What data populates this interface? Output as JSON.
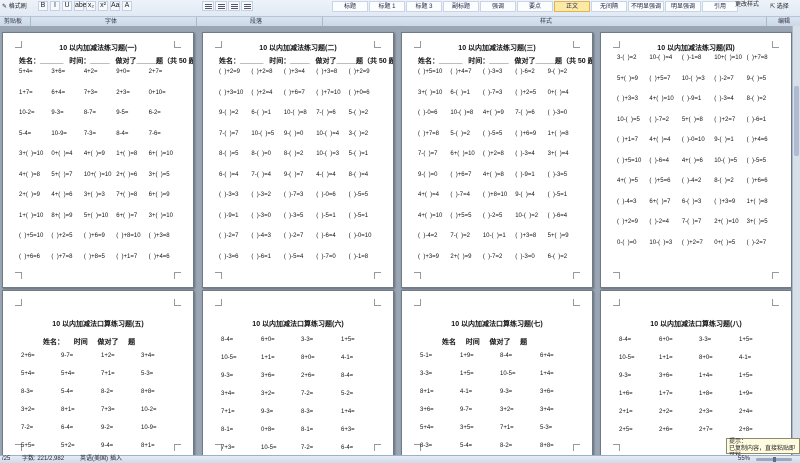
{
  "ribbon": {
    "format_painter": "格式刷",
    "font_buttons": [
      "B",
      "I",
      "U",
      "abe",
      "x₂",
      "x²",
      "Aa",
      "A"
    ],
    "para_buttons": [
      "≡",
      "≡",
      "≡",
      "≡"
    ],
    "styles": [
      "标题",
      "标题 1",
      "标题 3",
      "副标题",
      "强调",
      "要点",
      "正文",
      "无间隔",
      "不明显强调",
      "明显强调",
      "引用"
    ],
    "selected_style": "正文",
    "change_styles": "更改样式",
    "select": "选择",
    "groups": [
      "剪贴板",
      "字体",
      "段落",
      "样式",
      "编辑"
    ]
  },
  "pages": [
    {
      "title": "10 以内加减法练习题(一)",
      "info": "姓名：______   时间：_____   做对了_____题（共 50 题）",
      "rows": [
        [
          "5+4=",
          "3+6=",
          "4+2=",
          "9+0=",
          "2+7="
        ],
        [
          "1+7=",
          "6+4=",
          "7+3=",
          "2+3=",
          "0+10="
        ],
        [
          "10-2=",
          "9-3=",
          "8-7=",
          "9-5=",
          "6-2="
        ],
        [
          "5-4=",
          "10-9=",
          "7-3=",
          "8-4=",
          "7-6="
        ],
        [
          "3+(  )=10",
          "0+(  )=4",
          "4+(  )=9",
          "1+(  )=8",
          "6+(  )=10"
        ],
        [
          "4+(  )=8",
          "5+(  )=7",
          "10+(  )=10",
          "2+(  )=6",
          "3+(  )=5"
        ],
        [
          "2+(  )=9",
          "4+(  )=6",
          "3+(  )=3",
          "7+(  )=8",
          "6+(  )=9"
        ],
        [
          "1+(  )=10",
          "8+(  )=9",
          "5+(  )=10",
          "6+(  )=7",
          "3+(  )=10"
        ],
        [
          "(  )+5=10",
          "(  )+2=5",
          "(  )+6=9",
          "(  )+8=10",
          "(  )+3=8"
        ],
        [
          "(  )+6=6",
          "(  )+7=8",
          "(  )+8=5",
          "(  )+1=7",
          "(  )+4=6"
        ]
      ]
    },
    {
      "title": "10 以内加减法练习题(二)",
      "info": "姓名：______   时间：_____   做对了_____题（共 50 题）",
      "rows": [
        [
          "(  )+2=9",
          "(  )+2=8",
          "(  )+3=4",
          "(  )+3=8",
          "(  )+2=9"
        ],
        [
          "(  )+3=10",
          "(  )+2=4",
          "(  )+6=7",
          "(  )+7=10",
          "(  )+0=6"
        ],
        [
          "9-(  )=2",
          "6-(  )=1",
          "10-(  )=8",
          "7-(  )=6",
          "5-(  )=2"
        ],
        [
          "7-(  )=7",
          "10-(  )=5",
          "9-(  )=0",
          "10-(  )=4",
          "3-(  )=2"
        ],
        [
          "8-(  )=5",
          "8-(  )=0",
          "8-(  )=2",
          "10-(  )=3",
          "5-(  )=1"
        ],
        [
          "6-(  )=4",
          "7-(  )=4",
          "9-(  )=7",
          "4-(  )=4",
          "8-(  )=4"
        ],
        [
          "(  )-3=3",
          "(  )-3=2",
          "(  )-7=3",
          "(  )-0=6",
          "(  )-5=5"
        ],
        [
          "(  )-9=1",
          "(  )-3=0",
          "(  )-3=5",
          "(  )-5=1",
          "(  )-5=1"
        ],
        [
          "(  )-2=7",
          "(  )-4=3",
          "(  )-2=7",
          "(  )-6=4",
          "(  )-0=10"
        ],
        [
          "(  )-3=6",
          "(  )-6=1",
          "(  )-5=4",
          "(  )-7=0",
          "(  )-1=8"
        ]
      ]
    },
    {
      "title": "10 以内加减法练习题(三)",
      "info": "姓名：______   时间：_____   做对了_____题（共 50 题）",
      "rows": [
        [
          "(  )+5=10",
          "(  )+4=7",
          "(  )-3=3",
          "(  )-6=2",
          "9-(  )=2"
        ],
        [
          "3+(  )=10",
          "6-(  )=1",
          "(  )-7=3",
          "(  )+2=5",
          "0+(  )=4"
        ],
        [
          "(  )-0=6",
          "10-(  )=8",
          "4+(  )=9",
          "7-(  )=6",
          "(  )-3=0"
        ],
        [
          "(  )+7=8",
          "5-(  )=2",
          "(  )-5=5",
          "(  )+6=9",
          "1+(  )=8"
        ],
        [
          "7-(  )=7",
          "6+(  )=10",
          "(  )+2=8",
          "(  )-3=4",
          "3+(  )=4"
        ],
        [
          "9-(  )=0",
          "(  )+6=7",
          "4+(  )=8",
          "(  )-9=1",
          "(  )-3=5"
        ],
        [
          "4+(  )=4",
          "(  )-7=4",
          "(  )+8=10",
          "9-(  )=4",
          "(  )-5=1"
        ],
        [
          "4+(  )=10",
          "(  )+5=5",
          "(  )-2=5",
          "10-(  )=2",
          "(  )-6=4"
        ],
        [
          "(  )-4=2",
          "7-(  )=2",
          "10-(  )=1",
          "(  )+3=8",
          "5+(  )=9"
        ],
        [
          "(  )+3=9",
          "2+(  )=9",
          "(  )-7=2",
          "(  )-3=0",
          "6-(  )=2"
        ]
      ]
    },
    {
      "title": "10 以内加减法练习题(四)",
      "info": "",
      "rows": [
        [
          "3-(  )=2",
          "10-(  )=4",
          "(  )-1=8",
          "10+(  )=10",
          "(  )+7=8"
        ],
        [
          "5+(  )=9",
          "(  )+5=7",
          "10-(  )=3",
          "(  )-2=7",
          "9-(  )=5"
        ],
        [
          "(  )+3=3",
          "4+(  )=10",
          "(  )-9=1",
          "(  )-3=4",
          "8-(  )=2"
        ],
        [
          "10-(  )=5",
          "(  )-7=2",
          "5+(  )=8",
          "(  )+2=7",
          "(  )-6=1"
        ],
        [
          "(  )+1=7",
          "4+(  )=4",
          "(  )-0=10",
          "9-(  )=1",
          "(  )+4=6"
        ],
        [
          "(  )+5=10",
          "(  )-6=4",
          "4+(  )=6",
          "10-(  )=5",
          "(  )-5=5"
        ],
        [
          "4+(  )=5",
          "(  )+5=6",
          "(  )-4=2",
          "8-(  )=2",
          "(  )+6=6"
        ],
        [
          "(  )-4=3",
          "6+(  )=7",
          "6-(  )=3",
          "(  )+3=9",
          "1+(  )=8"
        ],
        [
          "(  )+2=9",
          "(  )-2=4",
          "7-(  )=7",
          "2+(  )=10",
          "3+(  )=5"
        ],
        [
          "0-(  )=0",
          "10-(  )=3",
          "(  )+2=7",
          "0+(  )=5",
          "(  )-2=7"
        ]
      ]
    },
    {
      "title": "10 以内加减法口算练习题(五)",
      "info": "姓名：     时间     做对了     题",
      "rows": [
        [
          "2+6=",
          "9-7=",
          "1+2=",
          "3+4="
        ],
        [
          "5+4=",
          "5+4=",
          "7+1=",
          "5-3="
        ],
        [
          "8-3=",
          "5-4=",
          "8-2=",
          "8+8="
        ],
        [
          "3+2=",
          "8+1=",
          "7+3=",
          "10-2="
        ],
        [
          "7-2=",
          "6-4=",
          "9-2=",
          "10-9="
        ],
        [
          "5+5=",
          "5+2=",
          "9-4=",
          "8+1="
        ]
      ]
    },
    {
      "title": "10 以内加减法口算练习题(六)",
      "info": "",
      "rows": [
        [
          "8-4=",
          "6+0=",
          "3-3=",
          "1+5="
        ],
        [
          "10-5=",
          "1+1=",
          "8+0=",
          "4-1="
        ],
        [
          "9-3=",
          "3+6=",
          "2+6=",
          "8-4="
        ],
        [
          "3+4=",
          "3+2=",
          "7-2=",
          "5-2="
        ],
        [
          "7+1=",
          "9-3=",
          "8-3=",
          "1+4="
        ],
        [
          "8-1=",
          "0+8=",
          "8-1=",
          "6+3="
        ],
        [
          "7+3=",
          "10-5=",
          "7-2=",
          "6-4="
        ]
      ]
    },
    {
      "title": "10 以内加减法口算练习题(七)",
      "info": "姓名     时间     做对了     题",
      "rows": [
        [
          "5-1=",
          "1+9=",
          "8-4=",
          "6+4="
        ],
        [
          "3-3=",
          "1+5=",
          "10-5=",
          "1+4="
        ],
        [
          "8+1=",
          "4-1=",
          "9-3=",
          "3+6="
        ],
        [
          "3+6=",
          "9-7=",
          "3+2=",
          "3+4="
        ],
        [
          "5+4=",
          "3+5=",
          "7+1=",
          "5-3="
        ],
        [
          "8-3=",
          "5-4=",
          "8-2=",
          "8+8="
        ]
      ]
    },
    {
      "title": "10 以内加减法口算练习题(八)",
      "info": "",
      "rows": [
        [
          "8-4=",
          "6+0=",
          "3-3=",
          "1+5="
        ],
        [
          "10-5=",
          "1+1=",
          "8+0=",
          "4-1="
        ],
        [
          "9-3=",
          "3+6=",
          "1+4=",
          "1+5="
        ],
        [
          "1+6=",
          "1+7=",
          "1+8=",
          "1+9="
        ],
        [
          "2+1=",
          "2+2=",
          "2+3=",
          "2+4="
        ],
        [
          "2+5=",
          "2+6=",
          "2+7=",
          "2+8="
        ]
      ]
    }
  ],
  "status": {
    "page": "/25",
    "words": "字数: 221/2,982",
    "lang": "英语(美国)",
    "mode": "插入",
    "zoom": "55%"
  },
  "tip": {
    "line1": "提示：",
    "line2": "已复制内容，直接粘贴即可粘"
  }
}
